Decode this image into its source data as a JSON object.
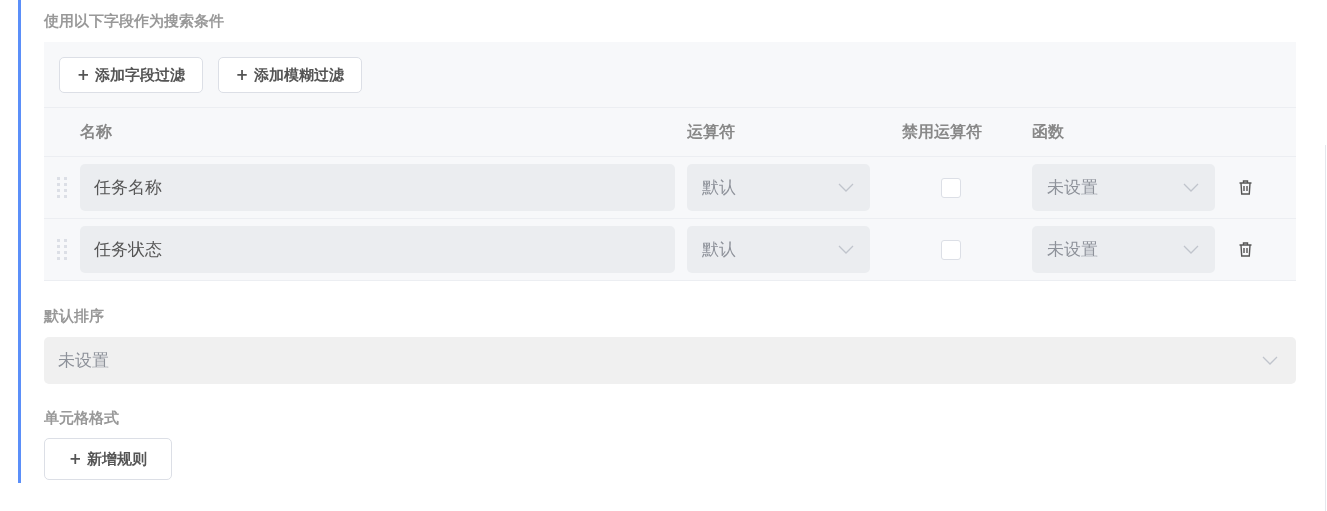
{
  "search_section": {
    "label": "使用以下字段作为搜索条件",
    "buttons": [
      "+ 添加字段过滤",
      "+ 添加模糊过滤"
    ],
    "columns": [
      "名称",
      "运算符",
      "禁用运算符",
      "函数"
    ],
    "rows": [
      {
        "name": "任务名称",
        "operator": "默认",
        "disable_operator": false,
        "function": "未设置"
      },
      {
        "name": "任务状态",
        "operator": "默认",
        "disable_operator": false,
        "function": "未设置"
      }
    ]
  },
  "default_sort": {
    "label": "默认排序",
    "placeholder": "未设置"
  },
  "cell_format": {
    "label": "单元格格式",
    "button": "+ 新增规则"
  }
}
